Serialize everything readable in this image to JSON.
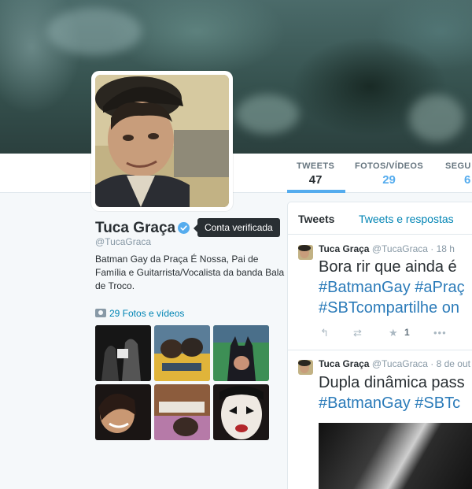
{
  "profile": {
    "name": "Tuca Graça",
    "screen_name": "@TucaGraca",
    "verified_tooltip": "Conta verificada",
    "bio": "Batman Gay da Praça É Nossa, Pai de Família e Guitarrista/Vocalista da banda Bala de Troco.",
    "photos_link": "29 Fotos e vídeos"
  },
  "stats": [
    {
      "label": "TWEETS",
      "value": "47"
    },
    {
      "label": "FOTOS/VÍDEOS",
      "value": "29"
    },
    {
      "label": "SEGU",
      "value": "6"
    }
  ],
  "timeline": {
    "tabs": [
      "Tweets",
      "Tweets e respostas"
    ],
    "tweets": [
      {
        "name": "Tuca Graça",
        "handle": "@TucaGraca",
        "time": "· 18 h",
        "line1": "Bora rir que ainda é",
        "line2_tags": [
          "#BatmanGay",
          "#aPraç"
        ],
        "line3_tags": [
          "#SBTcompartilhe on"
        ],
        "favorites": "1"
      },
      {
        "name": "Tuca Graça",
        "handle": "@TucaGraca",
        "time": "· 8 de out",
        "line1": "Dupla dinâmica pass",
        "line2_tags": [
          "#BatmanGay",
          "#SBTc"
        ]
      }
    ]
  },
  "colors": {
    "accent": "#55acee",
    "link": "#0084b4",
    "hashtag": "#2b7bb9",
    "verified": "#55acee"
  }
}
